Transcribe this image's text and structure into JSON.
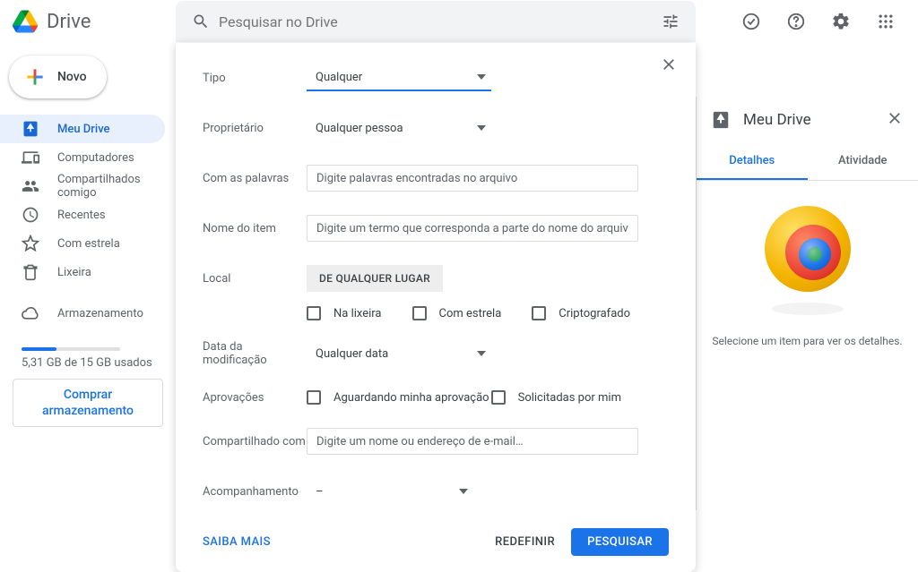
{
  "header": {
    "app_name": "Drive",
    "search_placeholder": "Pesquisar no Drive"
  },
  "sidebar": {
    "new_label": "Novo",
    "items": [
      {
        "label": "Meu Drive",
        "icon": "drive"
      },
      {
        "label": "Computadores",
        "icon": "devices"
      },
      {
        "label": "Compartilhados comigo",
        "icon": "people"
      },
      {
        "label": "Recentes",
        "icon": "clock"
      },
      {
        "label": "Com estrela",
        "icon": "star"
      },
      {
        "label": "Lixeira",
        "icon": "trash"
      }
    ],
    "storage_label": "Armazenamento",
    "storage_used_text": "5,31 GB de 15 GB usados",
    "storage_percent": 35,
    "buy_label": "Comprar armazenamento"
  },
  "adv_search": {
    "type_label": "Tipo",
    "type_value": "Qualquer",
    "owner_label": "Proprietário",
    "owner_value": "Qualquer pessoa",
    "words_label": "Com as palavras",
    "words_placeholder": "Digite palavras encontradas no arquivo",
    "item_name_label": "Nome do item",
    "item_name_placeholder": "Digite um termo que corresponda a parte do nome do arquivo",
    "location_label": "Local",
    "location_button": "DE QUALQUER LUGAR",
    "chk_trash": "Na lixeira",
    "chk_starred": "Com estrela",
    "chk_encrypted": "Criptografado",
    "modified_label": "Data da modificação",
    "modified_value": "Qualquer data",
    "approvals_label": "Aprovações",
    "approvals_pending": "Aguardando minha aprovação",
    "approvals_requested": "Solicitadas por mim",
    "shared_with_label": "Compartilhado com",
    "shared_with_placeholder": "Digite um nome ou endereço de e-mail…",
    "followup_label": "Acompanhamento",
    "followup_value": "–",
    "learn_more": "SAIBA MAIS",
    "reset": "REDEFINIR",
    "search": "PESQUISAR"
  },
  "details": {
    "title": "Meu Drive",
    "tab_details": "Detalhes",
    "tab_activity": "Atividade",
    "empty_text": "Selecione um item para ver os detalhes."
  }
}
